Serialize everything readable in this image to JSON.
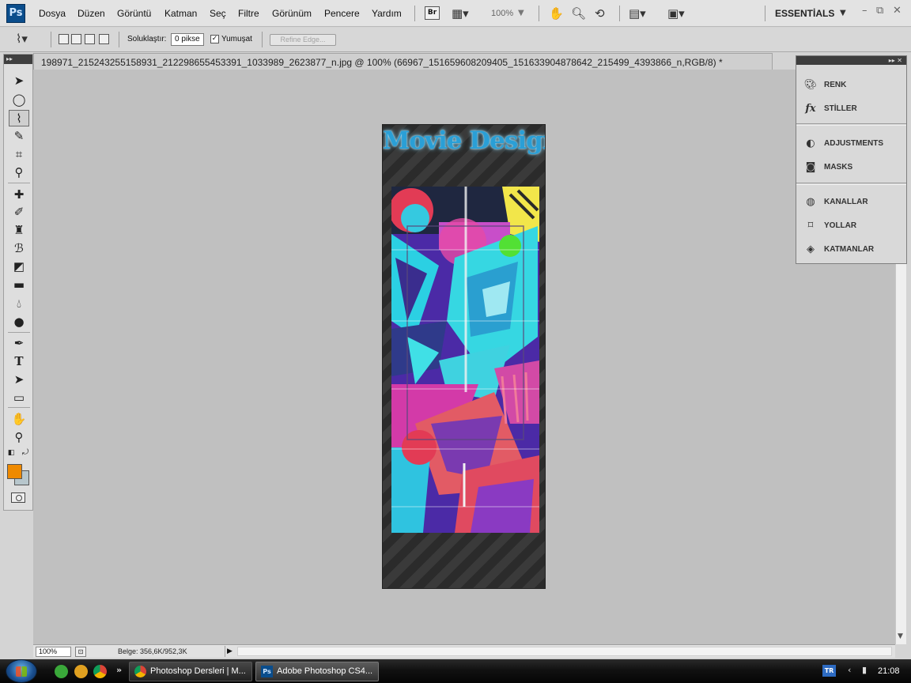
{
  "app": {
    "logo_text": "Ps",
    "menu": [
      "Dosya",
      "Düzen",
      "Görüntü",
      "Katman",
      "Seç",
      "Filtre",
      "Görünüm",
      "Pencere",
      "Yardım"
    ],
    "bridge_label": "Br",
    "zoom_level": "100%",
    "workspace": "ESSENTİALS",
    "window_controls": [
      "–",
      "⧉",
      "✕"
    ]
  },
  "options_bar": {
    "feather_label": "Soluklaştır:",
    "feather_value": "0 pikse",
    "antialias_checked": "✓",
    "antialias_label": "Yumuşat",
    "refine_edge_label": "Refine Edge..."
  },
  "document": {
    "tab_title": "198971_215243255158931_212298655453391_1033989_2623877_n.jpg @ 100% (66967_151659608209405_151633904878642_215499_4393866_n,RGB/8) *",
    "canvas_title": "Movie Design"
  },
  "colors": {
    "foreground": "#ef8a00",
    "background": "#b7c6cc",
    "panel_icon": "#444444"
  },
  "panels": [
    {
      "label": "RENK",
      "icon": "palette-icon"
    },
    {
      "label": "STİLLER",
      "icon": "fx-styles-icon"
    },
    {
      "label": "ADJUSTMENTS",
      "icon": "adjustments-icon"
    },
    {
      "label": "MASKS",
      "icon": "masks-icon"
    },
    {
      "label": "KANALLAR",
      "icon": "channels-icon"
    },
    {
      "label": "YOLLAR",
      "icon": "paths-icon"
    },
    {
      "label": "KATMANLAR",
      "icon": "layers-icon"
    }
  ],
  "status_bar": {
    "zoom": "100%",
    "doc_info": "Belge: 356,6K/952,3K"
  },
  "taskbar": {
    "tasks": [
      "Photoshop Dersleri | M...",
      "Adobe Photoshop CS4..."
    ],
    "language": "TR",
    "time": "21:08"
  }
}
